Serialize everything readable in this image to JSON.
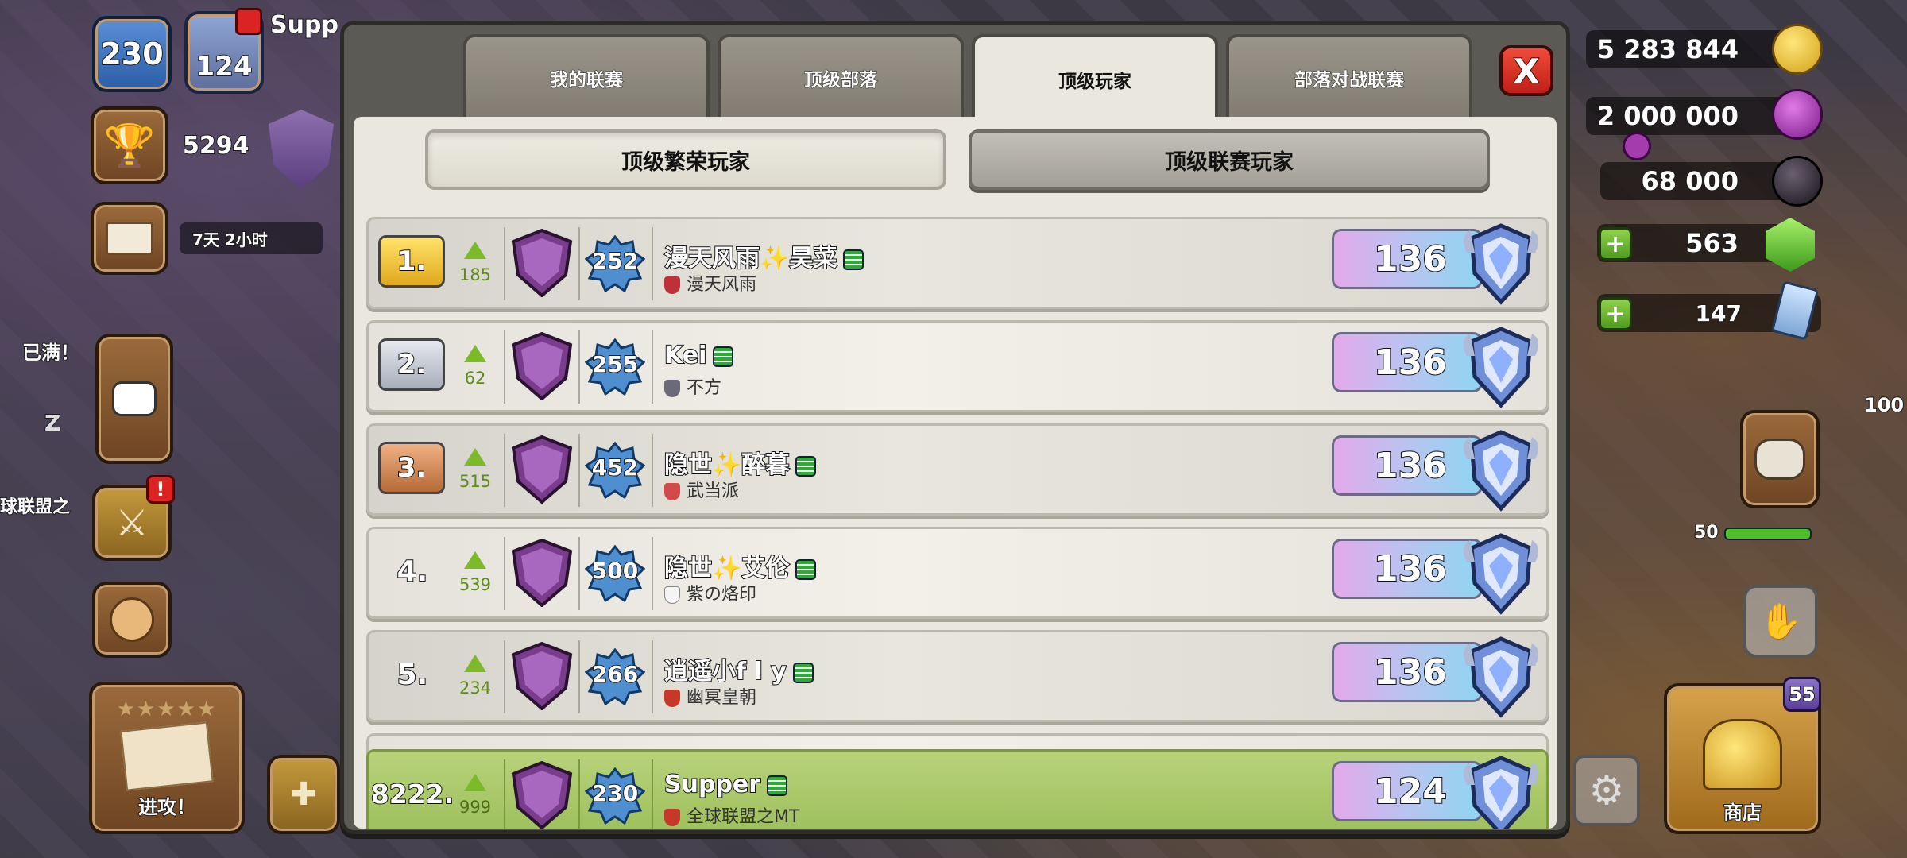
{
  "hud": {
    "level": "230",
    "shield_level": "124",
    "player_name_partial": "Supp",
    "trophies": "5294",
    "timer": "7天 2小时",
    "full_label": "已满！",
    "sleep_z": "Z",
    "global_label": "球联盟之",
    "attack_label": "进攻！",
    "shop_label": "商店",
    "shop_badge": "55",
    "gold": "5 283 844",
    "elixir": "2 000 000",
    "dark_elixir": "68 000",
    "gems": "563",
    "tickets": "147",
    "hp_100": "100",
    "hp_50": "50"
  },
  "tabs": [
    {
      "label": "我的联赛"
    },
    {
      "label": "顶级部落"
    },
    {
      "label": "顶级玩家"
    },
    {
      "label": "部落对战联赛"
    }
  ],
  "close_label": "X",
  "subtabs": {
    "prosperity": "顶级繁荣玩家",
    "league": "顶级联赛玩家"
  },
  "rows": [
    {
      "rank": "1.",
      "change": "185",
      "level": "252",
      "name": "漫天风雨✨昊菜",
      "clan": "漫天风雨",
      "score": "136"
    },
    {
      "rank": "2.",
      "change": "62",
      "level": "255",
      "name": "Kei",
      "clan": "不方",
      "score": "136"
    },
    {
      "rank": "3.",
      "change": "515",
      "level": "452",
      "name": "隐世✨醉暮",
      "clan": "武当派",
      "score": "136"
    },
    {
      "rank": "4.",
      "change": "539",
      "level": "500",
      "name": "隐世✨艾伦",
      "clan": "紫の烙印",
      "score": "136"
    },
    {
      "rank": "5.",
      "change": "234",
      "level": "266",
      "name": "逍遥小f l y",
      "clan": "幽冥皇朝",
      "score": "136"
    }
  ],
  "me": {
    "rank": "8222.",
    "change": "999",
    "level": "230",
    "name": "Supper",
    "clan": "全球联盟之MT",
    "score": "124"
  },
  "colors": {
    "gold_rank": "#f2c62c",
    "silver_rank": "#c9ccd6",
    "bronze_rank": "#d08f5c",
    "my_row": "#a8c96a"
  }
}
